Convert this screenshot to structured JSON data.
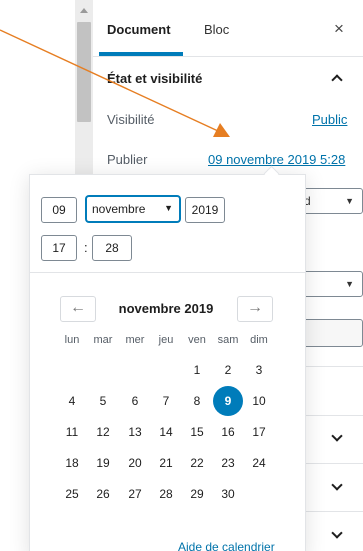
{
  "sidebar": {
    "tabs": [
      {
        "label": "Document",
        "active": true
      },
      {
        "label": "Bloc",
        "active": false
      }
    ],
    "close_label": "×",
    "section_title": "État et visibilité",
    "visibility": {
      "label": "Visibilité",
      "value": "Public"
    },
    "publish": {
      "label": "Publier",
      "value": "09 novembre 2019 5:28"
    },
    "partial_select_text": "rd",
    "partial_text": "s"
  },
  "datepicker": {
    "day": "09",
    "month": "novembre",
    "year": "2019",
    "hour": "17",
    "minute": "28",
    "colon": ":",
    "calendar": {
      "title": "novembre 2019",
      "prev_label": "←",
      "next_label": "→",
      "weekdays": [
        "lun",
        "mar",
        "mer",
        "jeu",
        "ven",
        "sam",
        "dim"
      ],
      "weeks": [
        [
          "",
          "",
          "",
          "",
          "1",
          "2",
          "3"
        ],
        [
          "4",
          "5",
          "6",
          "7",
          "8",
          "9",
          "10"
        ],
        [
          "11",
          "12",
          "13",
          "14",
          "15",
          "16",
          "17"
        ],
        [
          "18",
          "19",
          "20",
          "21",
          "22",
          "23",
          "24"
        ],
        [
          "25",
          "26",
          "27",
          "28",
          "29",
          "30",
          ""
        ]
      ],
      "selected_day": "9"
    },
    "help_label": "Aide de calendrier"
  },
  "colors": {
    "accent": "#007cba",
    "link": "#0073aa",
    "annotation_arrow": "#e67e22"
  }
}
